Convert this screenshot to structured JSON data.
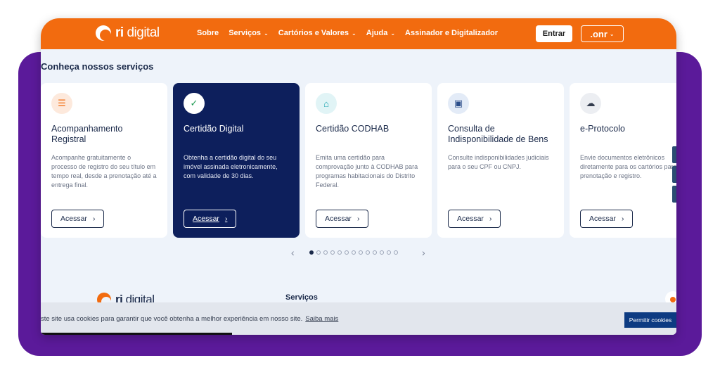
{
  "header": {
    "logo_ri": "ri",
    "logo_digital": " digital",
    "nav": [
      {
        "label": "Sobre",
        "has_dropdown": false
      },
      {
        "label": "Serviços",
        "has_dropdown": true
      },
      {
        "label": "Cartórios e Valores",
        "has_dropdown": true
      },
      {
        "label": "Ajuda",
        "has_dropdown": true
      },
      {
        "label": "Assinador e Digitalizador",
        "has_dropdown": false
      }
    ],
    "entrar_label": "Entrar",
    "onr_label": ".onr"
  },
  "section_title": "Conheça nossos serviços",
  "cards": [
    {
      "title": "Acompanhamento Registral",
      "desc": "Acompanhe gratuitamente o processo de registro do seu título em tempo real, desde a prenotação até a entrega final.",
      "button": "Acessar",
      "icon": "checklist-icon",
      "active": false
    },
    {
      "title": "Certidão Digital",
      "desc": "Obtenha a certidão digital do seu imóvel assinada eletronicamente, com validade de 30 dias.",
      "button": "Acessar",
      "icon": "document-check-icon",
      "active": true
    },
    {
      "title": "Certidão CODHAB",
      "desc": "Emita uma certidão para comprovação junto à CODHAB para programas habitacionais do Distrito Federal.",
      "button": "Acessar",
      "icon": "house-icon",
      "active": false
    },
    {
      "title": "Consulta de Indisponibilidade de Bens",
      "desc": "Consulte indisponibilidades judiciais para o seu CPF ou CNPJ.",
      "button": "Acessar",
      "icon": "lock-icon",
      "active": false
    },
    {
      "title": "e-Protocolo",
      "desc": "Envie documentos eletrônicos diretamente para os cartórios para prenotação e registro.",
      "button": "Acessar",
      "icon": "cloud-upload-icon",
      "active": false
    }
  ],
  "carousel": {
    "total_dots": 13,
    "active_index": 0
  },
  "footer": {
    "logo_ri": "ri",
    "logo_digital": " digital",
    "servicos_label": "Serviços"
  },
  "cookie": {
    "text": "ste site usa cookies para garantir que você obtenha a melhor experiência em nosso site.",
    "link": "Saiba mais",
    "button": "Permitir cookies"
  },
  "colors": {
    "brand_orange": "#f26b0f",
    "navy": "#0d1f5c",
    "purple_bg": "#5b1a9a"
  }
}
